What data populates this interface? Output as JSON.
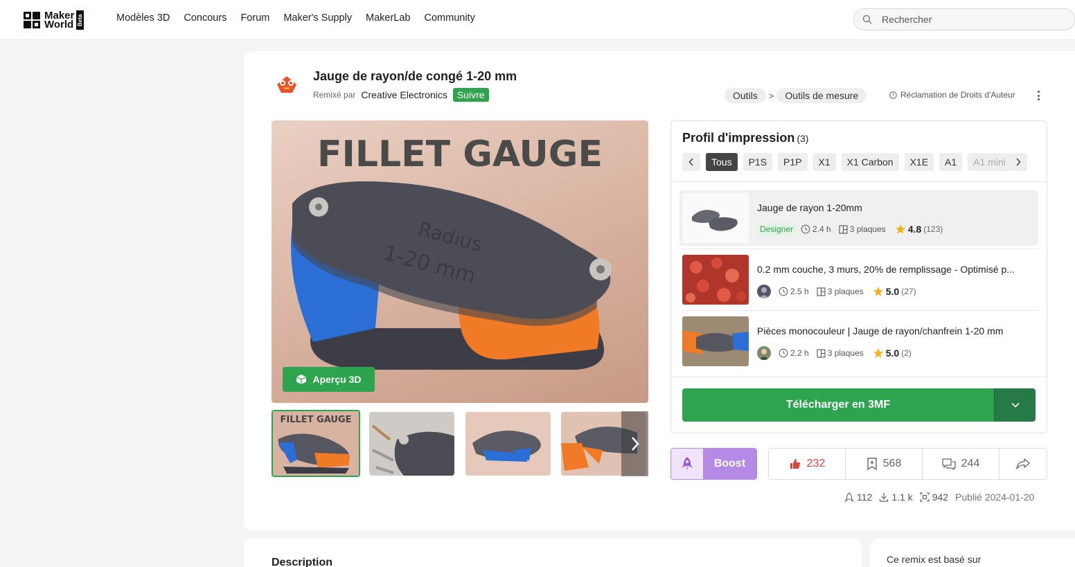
{
  "nav": {
    "logo_text_1": "Maker",
    "logo_text_2": "World",
    "logo_badge": "Beta",
    "items": [
      "Modèles 3D",
      "Concours",
      "Forum",
      "Maker's Supply",
      "MakerLab",
      "Community"
    ],
    "search_placeholder": "Rechercher"
  },
  "model": {
    "title": "Jauge de rayon/de congé 1-20 mm",
    "remix_label": "Remixé par",
    "author": "Creative Electronics",
    "follow_label": "Suivre",
    "breadcrumb": [
      "Outils",
      "Outils de mesure"
    ],
    "breadcrumb_sep": ">",
    "claim_label": "Réclamation de Droits d'Auteur",
    "preview_label": "Aperçu 3D",
    "hero_text_1": "FILLET GAUGE",
    "hero_text_2": "Radius",
    "hero_text_3": "1-20 mm",
    "thumb_1_text": "FILLET GAUGE"
  },
  "profile": {
    "title": "Profil d'impression",
    "count": "(3)",
    "filters": [
      "Tous",
      "P1S",
      "P1P",
      "X1",
      "X1 Carbon",
      "X1E",
      "A1",
      "A1 mini"
    ],
    "items": [
      {
        "name": "Jauge de rayon 1-20mm",
        "badge": "Designer",
        "time": "2.4 h",
        "plates": "3 plaques",
        "rating": "4.8",
        "reviews": "(123)"
      },
      {
        "name": "0.2 mm couche, 3 murs, 20% de remplissage - Optimisé p...",
        "time": "2.5 h",
        "plates": "3 plaques",
        "rating": "5.0",
        "reviews": "(27)"
      },
      {
        "name": "Pièces monocouleur | Jauge de rayon/chanfrein 1-20 mm",
        "time": "2.2 h",
        "plates": "3 plaques",
        "rating": "5.0",
        "reviews": "(2)"
      }
    ],
    "download_label": "Télécharger en 3MF"
  },
  "actions": {
    "boost_label": "Boost",
    "likes": "232",
    "collects": "568",
    "comments": "244"
  },
  "footer_stats": {
    "boosts": "112",
    "downloads": "1.1 k",
    "prints": "942",
    "published": "Publié 2024-01-20"
  },
  "lower": {
    "description_title": "Description",
    "remix_based": "Ce remix est basé sur"
  },
  "colors": {
    "accent": "#2ea44f",
    "boost": "#b58ae6",
    "like": "#d9463b"
  }
}
